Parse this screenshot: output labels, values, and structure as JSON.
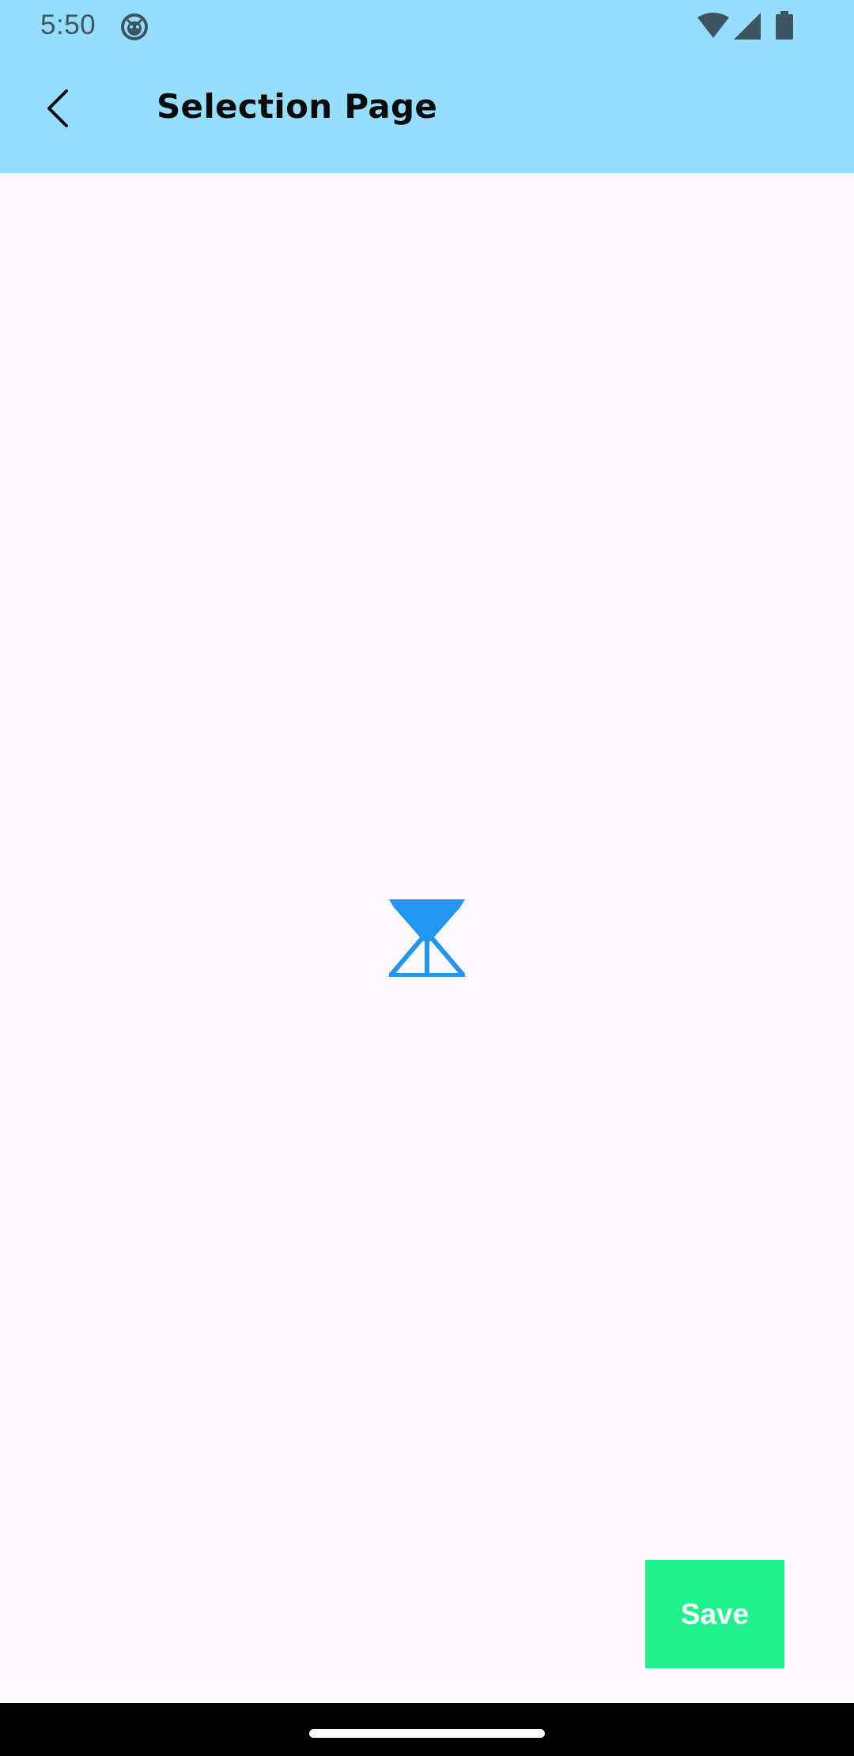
{
  "status_bar": {
    "time": "5:50",
    "app_icon": "android-debug-icon",
    "wifi_icon": "wifi-icon",
    "signal_icon": "cell-signal-icon",
    "battery_icon": "battery-icon"
  },
  "app_bar": {
    "back_icon": "chevron-left-icon",
    "title": "Selection Page",
    "background_color": "#96DEFF"
  },
  "main": {
    "loading_icon": "hourglass-icon",
    "loading_color": "#2196F3"
  },
  "actions": {
    "save_label": "Save",
    "save_color": "#22F28E"
  },
  "nav_bar": {
    "home_indicator": "home-indicator"
  }
}
